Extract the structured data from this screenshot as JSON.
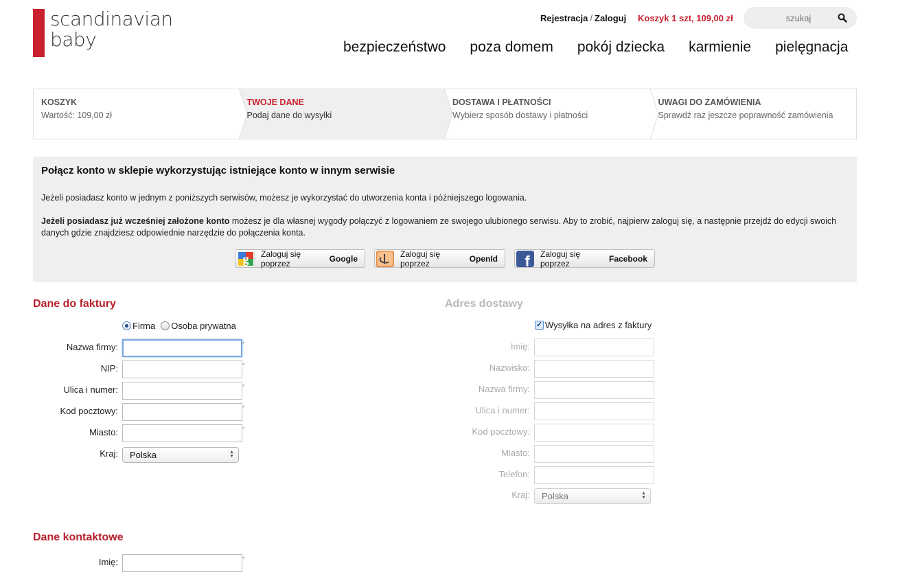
{
  "header": {
    "logo_line1": "scandinavian",
    "logo_line2": "baby",
    "register": "Rejestracja",
    "separator": "/",
    "login": "Zaloguj",
    "cart": "Koszyk 1 szt, 109,00 zł",
    "search_placeholder": "szukaj",
    "nav": [
      "bezpieczeństwo",
      "poza domem",
      "pokój dziecka",
      "karmienie",
      "pielęgnacja"
    ]
  },
  "steps": [
    {
      "title": "KOSZYK",
      "sub": "Wartość: 109,00 zł"
    },
    {
      "title": "TWOJE DANE",
      "sub": "Podaj dane do wysyłki"
    },
    {
      "title": "DOSTAWA I PŁATNOŚCI",
      "sub": "Wybierz sposób dostawy i płatności"
    },
    {
      "title": "UWAGI DO ZAMÓWIENIA",
      "sub": "Sprawdź raz jeszcze poprawność zamówienia"
    }
  ],
  "social": {
    "title": "Połącz konto w sklepie wykorzystując istniejące konto w innym serwisie",
    "p1": "Jeżeli posiadasz konto w jednym z poniższych serwisów, możesz je wykorzystać do utworzenia konta i późniejszego logowania.",
    "p2_bold": "Jeżeli posiadasz już wcześniej założone konto",
    "p2_rest": " możesz je dla własnej wygody połączyć z logowaniem ze swojego ulubionego serwisu. Aby to zrobić, najpierw zaloguj się, a następnie przejdź do edycji swoich danych gdzie znajdziesz odpowiednie narzędzie do połączenia konta.",
    "btn_prefix": "Zaloguj się poprzez",
    "btn_google": "Google",
    "btn_openid": "OpenId",
    "btn_facebook": "Facebook"
  },
  "invoice": {
    "title": "Dane do faktury",
    "radio_company": "Firma",
    "radio_private": "Osoba prywatna",
    "fields": [
      "Nazwa firmy:",
      "NIP:",
      "Ulica i numer:",
      "Kod pocztowy:",
      "Miasto:"
    ],
    "country_label": "Kraj:",
    "country_value": "Polska",
    "required_mark": "*"
  },
  "delivery": {
    "title": "Adres dostawy",
    "same_address": "Wysyłka na adres z faktury",
    "fields": [
      "Imię:",
      "Nazwisko:",
      "Nazwa firmy:",
      "Ulica i numer:",
      "Kod pocztowy:",
      "Miasto:",
      "Telefon:"
    ],
    "country_label": "Kraj:",
    "country_value": "Polska"
  },
  "contact": {
    "title": "Dane kontaktowe",
    "fields": [
      "Imię:"
    ]
  },
  "colors": {
    "brand_red": "#c8202f",
    "box_gray": "#efefef"
  }
}
